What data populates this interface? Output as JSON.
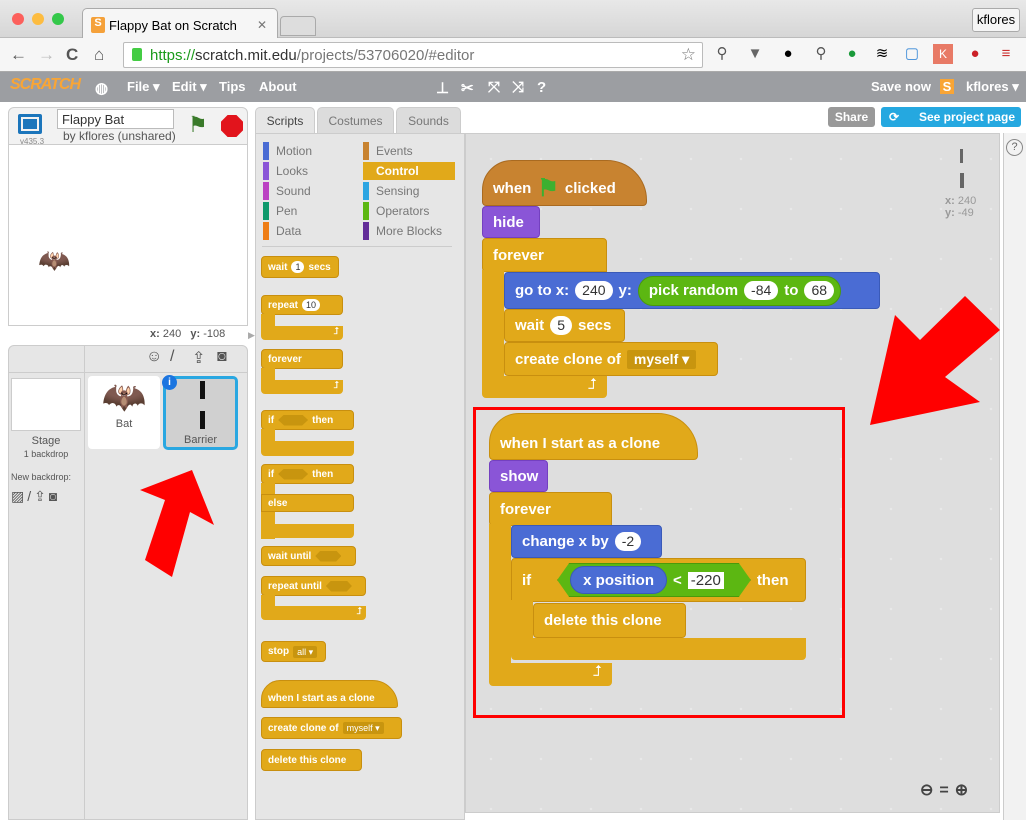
{
  "browser": {
    "tab_title": "Flappy Bat on Scratch",
    "profile": "kflores",
    "url_scheme": "https://",
    "url_host": "scratch.mit.edu",
    "url_path": "/projects/53706020/#editor"
  },
  "menu": {
    "logo": "SCRATCH",
    "file": "File ▾",
    "edit": "Edit ▾",
    "tips": "Tips",
    "about": "About",
    "save": "Save now",
    "user": "kflores ▾"
  },
  "project": {
    "title": "Flappy Bat",
    "author": "by kflores (unshared)",
    "version": "v435.3",
    "stage_x_label": "x:",
    "stage_x": "240",
    "stage_y_label": "y:",
    "stage_y": "-108"
  },
  "sprites": {
    "stage_label": "Stage",
    "stage_sub": "1 backdrop",
    "new_backdrop": "New backdrop:",
    "items": [
      {
        "name": "Bat"
      },
      {
        "name": "Barrier",
        "selected": true
      }
    ]
  },
  "tabs": [
    "Scripts",
    "Costumes",
    "Sounds"
  ],
  "share": "Share",
  "see_project": "See project page",
  "categories": [
    {
      "label": "Motion",
      "color": "#4a6cd4"
    },
    {
      "label": "Events",
      "color": "#c88330"
    },
    {
      "label": "Looks",
      "color": "#8a55d7"
    },
    {
      "label": "Control",
      "color": "#e1a91a",
      "active": true
    },
    {
      "label": "Sound",
      "color": "#bb42c3"
    },
    {
      "label": "Sensing",
      "color": "#2ca5e2"
    },
    {
      "label": "Pen",
      "color": "#0e9a6c"
    },
    {
      "label": "Operators",
      "color": "#5cb712"
    },
    {
      "label": "Data",
      "color": "#ee7d16"
    },
    {
      "label": "More Blocks",
      "color": "#632d99"
    }
  ],
  "palette": {
    "wait": "wait",
    "wait_val": "1",
    "secs": "secs",
    "repeat": "repeat",
    "repeat_val": "10",
    "forever": "forever",
    "if": "if",
    "then": "then",
    "else": "else",
    "wait_until": "wait until",
    "repeat_until": "repeat until",
    "stop": "stop",
    "stop_val": "all ▾",
    "clone_hat": "when I start as a clone",
    "create_clone": "create clone of",
    "create_val": "myself ▾",
    "delete_clone": "delete this clone"
  },
  "script1": {
    "when": "when",
    "clicked": "clicked",
    "hide": "hide",
    "forever": "forever",
    "goto": "go to x:",
    "x": "240",
    "y": "y:",
    "pick": "pick random",
    "from": "-84",
    "to": "to",
    "to_val": "68",
    "wait": "wait",
    "wait_val": "5",
    "secs": "secs",
    "create": "create clone of",
    "create_val": "myself ▾"
  },
  "script2": {
    "hat": "when I start as a clone",
    "show": "show",
    "forever": "forever",
    "change": "change x by",
    "change_val": "-2",
    "if": "if",
    "xpos": "x position",
    "lt": "<",
    "cmp": "-220",
    "then": "then",
    "delete": "delete this clone"
  },
  "sprite_info": {
    "x_label": "x:",
    "x": "240",
    "y_label": "y:",
    "y": "-49"
  },
  "annotation_color": "#ff0000"
}
